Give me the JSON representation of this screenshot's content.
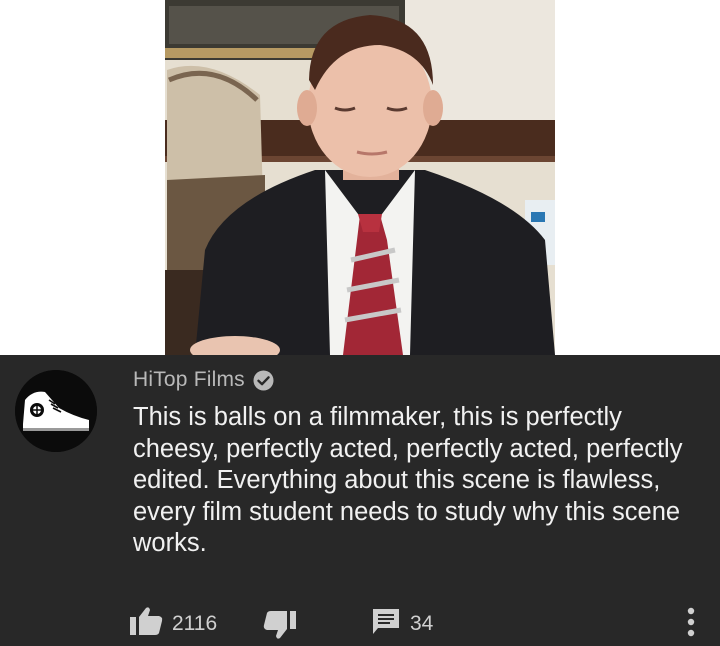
{
  "comment": {
    "author": "HiTop Films",
    "text": "This is balls on a filmmaker, this is perfectly cheesy, perfectly acted, perfectly acted, perfectly edited. Everything about this scene is flawless, every film student needs to study why this scene works.",
    "verified": true
  },
  "actions": {
    "likes": "2116",
    "replies": "34"
  },
  "icons": {
    "like": "thumbs-up-icon",
    "dislike": "thumbs-down-icon",
    "reply": "comment-icon",
    "more": "more-vert-icon",
    "verified": "verified-check-icon"
  },
  "colors": {
    "panel_background": "#282828",
    "comment_text": "#f1f1f1",
    "author_text": "#b9b9b9"
  }
}
